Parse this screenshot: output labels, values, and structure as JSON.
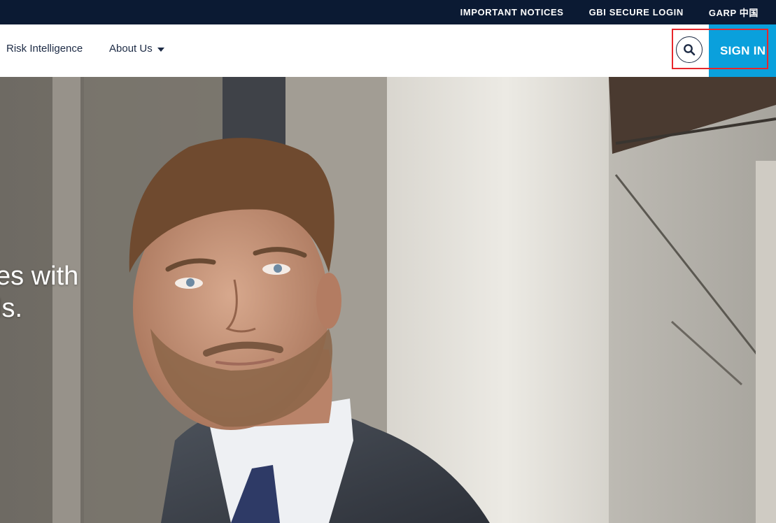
{
  "utility_bar": {
    "links": [
      "IMPORTANT NOTICES",
      "GBI SECURE LOGIN",
      "GARP 中国"
    ]
  },
  "nav": {
    "items": [
      {
        "label": "Risk Intelligence"
      },
      {
        "label": "About Us"
      }
    ],
    "search_icon": "search-icon",
    "sign_in_label": "SIGN IN"
  },
  "hero": {
    "headline_line1": "es with",
    "headline_line2": "ls.",
    "image": "man-in-suit-photo"
  },
  "colors": {
    "utility_bar_bg": "#0b1a33",
    "nav_text": "#1d2b45",
    "sign_in_bg": "#0aa0dc",
    "highlight": "#e8262b"
  }
}
